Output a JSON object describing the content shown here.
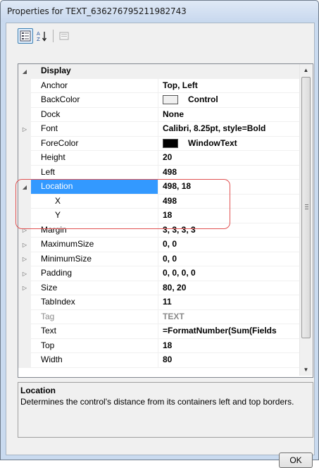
{
  "window": {
    "title": "Properties for TEXT_636276795211982743"
  },
  "toolbar": {
    "categorized_icon": "categorized-view-icon",
    "alphabetical_icon": "sort-alphabetical-icon",
    "property_pages_icon": "property-pages-icon",
    "alpha_label": "A Z"
  },
  "grid": {
    "rows": [
      {
        "kind": "category",
        "name": "Display",
        "expander": "◢"
      },
      {
        "name": "Anchor",
        "value": "Top, Left"
      },
      {
        "name": "BackColor",
        "value": "Control",
        "swatch": "#f0f0f0"
      },
      {
        "name": "Dock",
        "value": "None"
      },
      {
        "name": "Font",
        "value": "Calibri, 8.25pt, style=Bold",
        "expander": "▷"
      },
      {
        "name": "ForeColor",
        "value": "WindowText",
        "swatch": "#000000"
      },
      {
        "name": "Height",
        "value": "20"
      },
      {
        "name": "Left",
        "value": "498"
      },
      {
        "name": "Location",
        "value": "498, 18",
        "expander": "◢",
        "selected": true
      },
      {
        "name": "X",
        "value": "498",
        "indent": true
      },
      {
        "name": "Y",
        "value": "18",
        "indent": true
      },
      {
        "name": "Margin",
        "value": "3, 3, 3, 3",
        "expander": "▷"
      },
      {
        "name": "MaximumSize",
        "value": "0, 0",
        "expander": "▷"
      },
      {
        "name": "MinimumSize",
        "value": "0, 0",
        "expander": "▷"
      },
      {
        "name": "Padding",
        "value": "0, 0, 0, 0",
        "expander": "▷"
      },
      {
        "name": "Size",
        "value": "80, 20",
        "expander": "▷"
      },
      {
        "name": "TabIndex",
        "value": "11"
      },
      {
        "name": "Tag",
        "value": "TEXT",
        "readonly": true
      },
      {
        "name": "Text",
        "value": "=FormatNumber(Sum(Fields"
      },
      {
        "name": "Top",
        "value": "18"
      },
      {
        "name": "Width",
        "value": "80"
      }
    ]
  },
  "description": {
    "title": "Location",
    "text": "Determines the control's distance from its containers left and top borders."
  },
  "buttons": {
    "ok": "OK"
  },
  "colors": {
    "selection": "#3399ff",
    "highlight_outline": "#e15252"
  }
}
